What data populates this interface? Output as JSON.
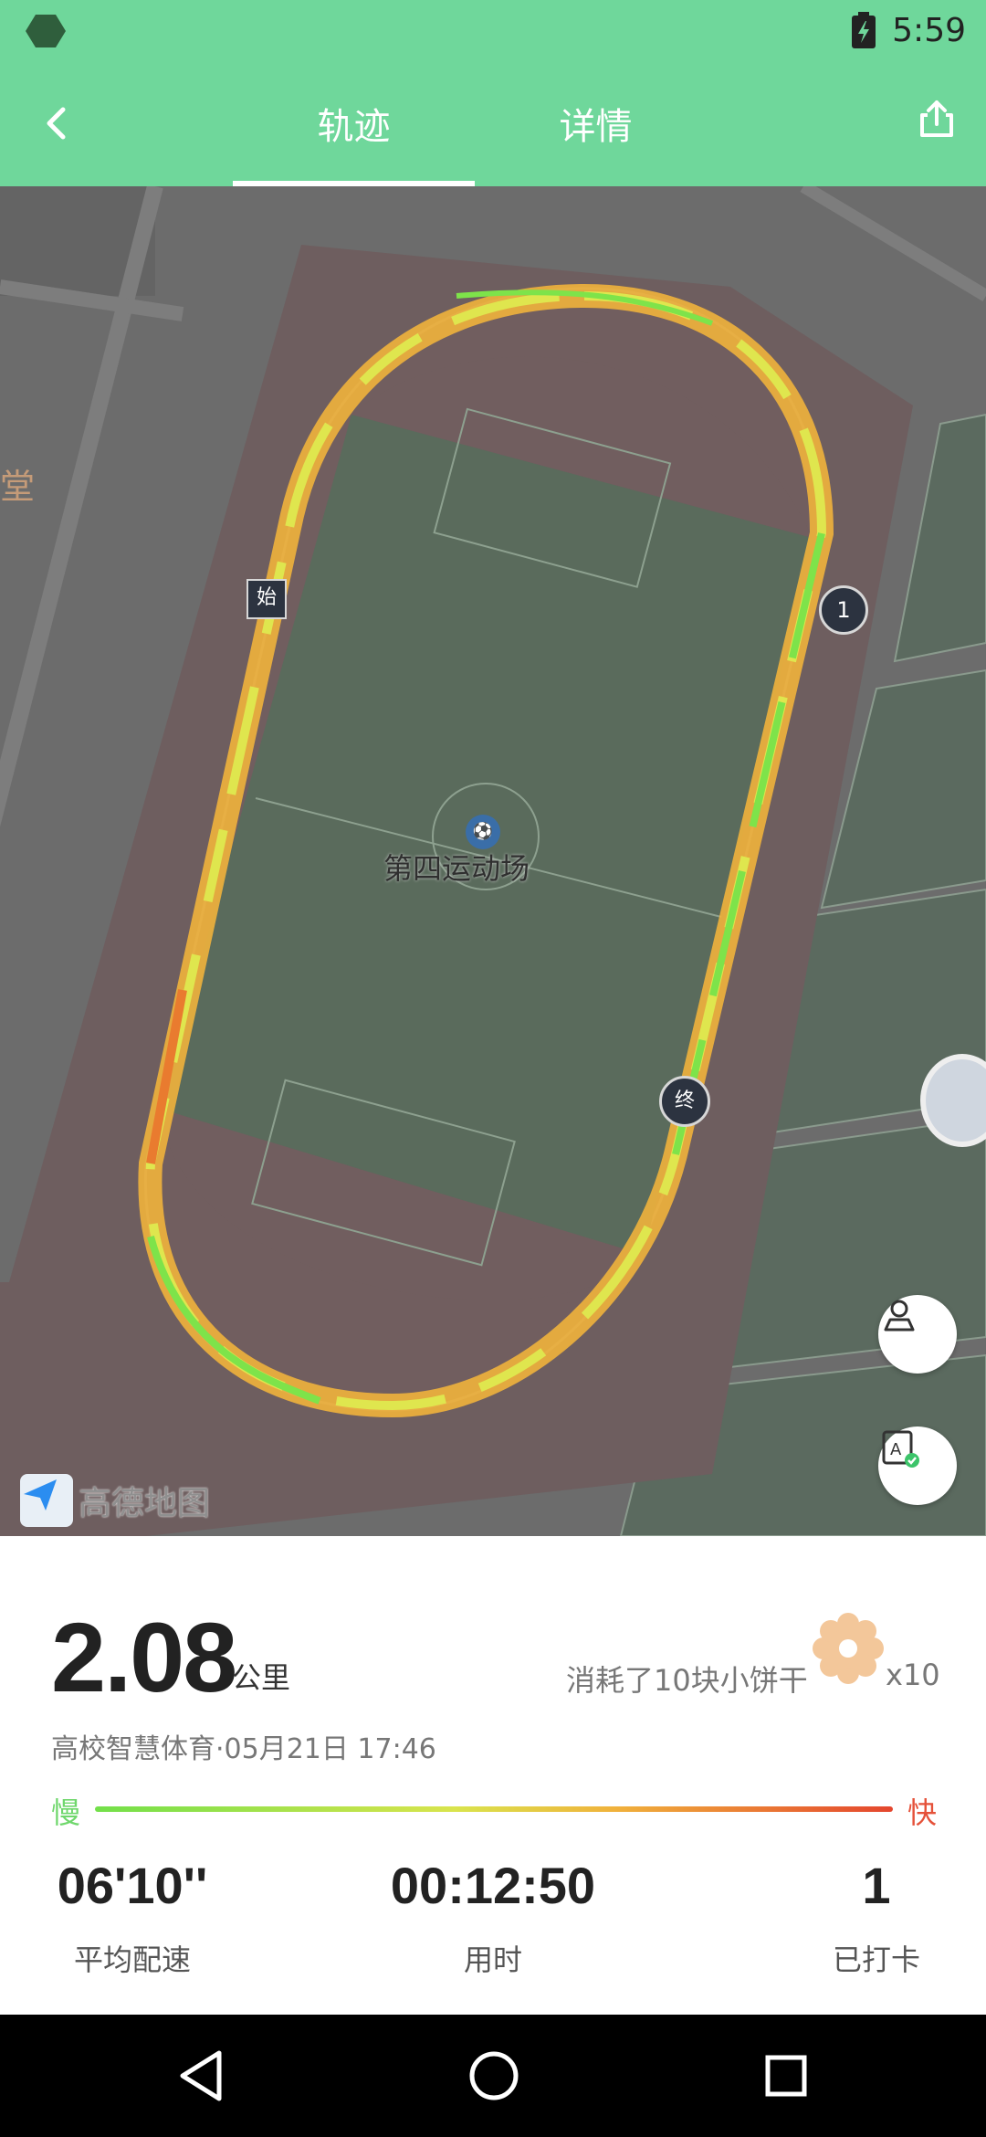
{
  "status": {
    "time": "5:59"
  },
  "header": {
    "tabs": [
      "轨迹",
      "详情"
    ],
    "active_tab": 0
  },
  "map": {
    "side_label": "堂",
    "venue": "第四运动场",
    "marker_start": "始",
    "marker_lap": "1",
    "marker_end": "终",
    "provider": "高德地图"
  },
  "summary": {
    "distance": "2.08",
    "distance_unit": "公里",
    "cookies_text": "消耗了10块小饼干",
    "cookies_mult": "x10",
    "source_line": "高校智慧体育·05月21日 17:46",
    "slow_label": "慢",
    "fast_label": "快",
    "stats": [
      {
        "value": "06'10''",
        "label": "平均配速"
      },
      {
        "value": "00:12:50",
        "label": "用时"
      },
      {
        "value": "1",
        "label": "已打卡"
      }
    ]
  }
}
